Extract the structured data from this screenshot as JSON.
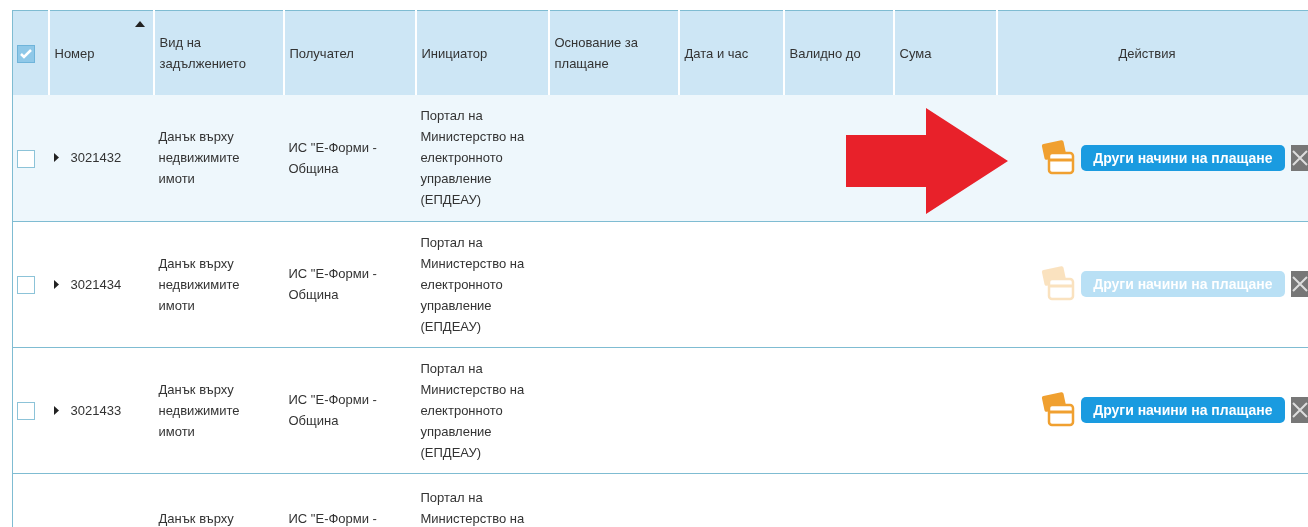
{
  "table": {
    "select_all": {
      "checked": true
    },
    "columns": [
      {
        "label": "Номер",
        "sorted_ascending": true
      },
      {
        "label": "Вид на задължението"
      },
      {
        "label": "Получател"
      },
      {
        "label": "Инициатор"
      },
      {
        "label": "Основание за плащане"
      },
      {
        "label": "Дата и час"
      },
      {
        "label": "Валидно до"
      },
      {
        "label": "Сума"
      },
      {
        "label": "Действия"
      }
    ],
    "rows": [
      {
        "kind": "full",
        "highlighted": true,
        "disabled": false,
        "checked": false,
        "number": "3021432",
        "type": "Данък върху недвижимите имоти",
        "recipient": "ИС \"Е-Форми - Община",
        "initiator": "Портал на Министерство на електронното управление (ЕПДЕАУ)",
        "action": "Други начини на плащане"
      },
      {
        "kind": "full",
        "highlighted": false,
        "disabled": true,
        "checked": false,
        "number": "3021434",
        "type": "Данък върху недвижимите имоти",
        "recipient": "ИС \"Е-Форми - Община",
        "initiator": "Портал на Министерство на електронното управление (ЕПДЕАУ)",
        "action": "Други начини на плащане"
      },
      {
        "kind": "full",
        "highlighted": false,
        "disabled": false,
        "checked": false,
        "number": "3021433",
        "type": "Данък върху недвижимите имоти",
        "recipient": "ИС \"Е-Форми - Община",
        "initiator": "Портал на Министерство на електронното управление (ЕПДЕАУ)",
        "action": "Други начини на плащане"
      },
      {
        "kind": "partial",
        "type": "Данък върху",
        "recipient": "ИС \"Е-Форми -",
        "initiator": "Портал на Министерство на"
      }
    ]
  },
  "annotation": {
    "kind": "arrow"
  }
}
